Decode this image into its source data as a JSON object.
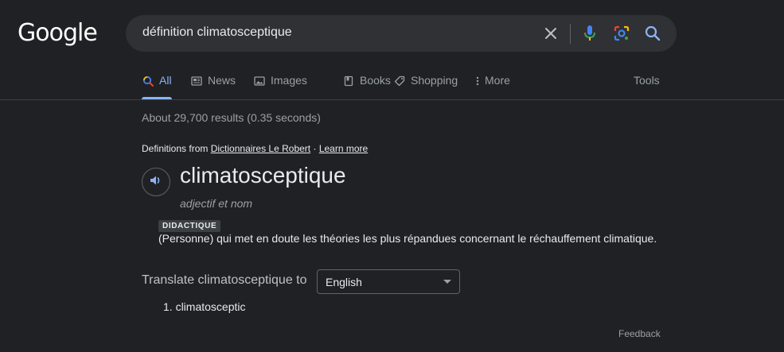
{
  "header": {
    "logo_text": "Google",
    "search_query": "définition climatosceptique"
  },
  "tabs": [
    {
      "label": "All",
      "icon": "search-icon",
      "active": true
    },
    {
      "label": "News",
      "icon": "news-icon",
      "active": false
    },
    {
      "label": "Images",
      "icon": "image-icon",
      "active": false
    },
    {
      "label": "Books",
      "icon": "book-icon",
      "active": false
    },
    {
      "label": "Shopping",
      "icon": "tag-icon",
      "active": false
    },
    {
      "label": "More",
      "icon": "more-vert-icon",
      "active": false
    }
  ],
  "tools_label": "Tools",
  "result_stats": "About 29,700 results (0.35 seconds)",
  "definitions": {
    "source_prefix": "Definitions from",
    "source_name": "Dictionnaires Le Robert",
    "separator": "·",
    "learn_more": "Learn more",
    "word": "climatosceptique",
    "part_of_speech": "adjectif et nom",
    "register": "DIDACTIQUE",
    "definition": "(Personne) qui met en doute les théories les plus répandues concernant le réchauffement climatique."
  },
  "translate": {
    "label": "Translate climatosceptique to",
    "language": "English",
    "results": [
      "1. climatosceptic"
    ]
  },
  "feedback_label": "Feedback",
  "colors": {
    "background": "#202124",
    "accent": "#8ab4f8",
    "text_primary": "#e8eaed",
    "text_secondary": "#9aa0a6"
  }
}
